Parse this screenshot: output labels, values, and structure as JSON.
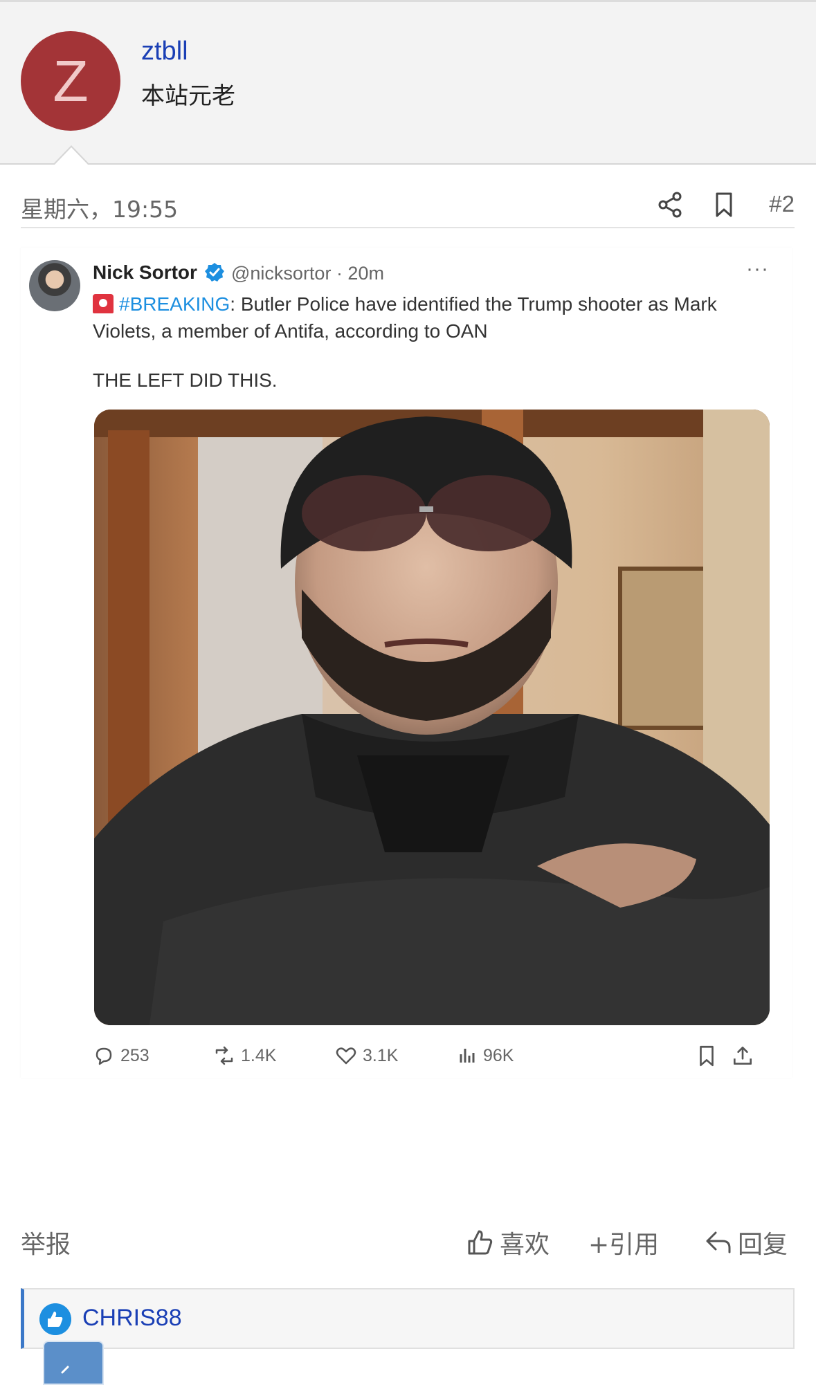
{
  "user": {
    "avatar_letter": "Z",
    "name": "ztbll",
    "title": "本站元老"
  },
  "post": {
    "time": "星期六，19:55",
    "number": "#2"
  },
  "tweet": {
    "author_name": "Nick Sortor",
    "handle_time": "@nicksortor · 20m",
    "more": "···",
    "hashtag": "#BREAKING",
    "body": ": Butler Police have identified the Trump shooter as Mark Violets, a member of Antifa, according to OAN",
    "body2": "THE LEFT DID THIS.",
    "stats": {
      "replies": "253",
      "retweets": "1.4K",
      "likes": "3.1K",
      "views": "96K"
    }
  },
  "actions": {
    "report": "举报",
    "like": "喜欢",
    "quote": "+引用",
    "reply": "回复"
  },
  "likes_bar": {
    "user": "CHRIS88"
  },
  "colors": {
    "avatar_bg": "#a33437",
    "link_blue": "#1a3fb5",
    "tweet_blue": "#1d8fe0"
  }
}
